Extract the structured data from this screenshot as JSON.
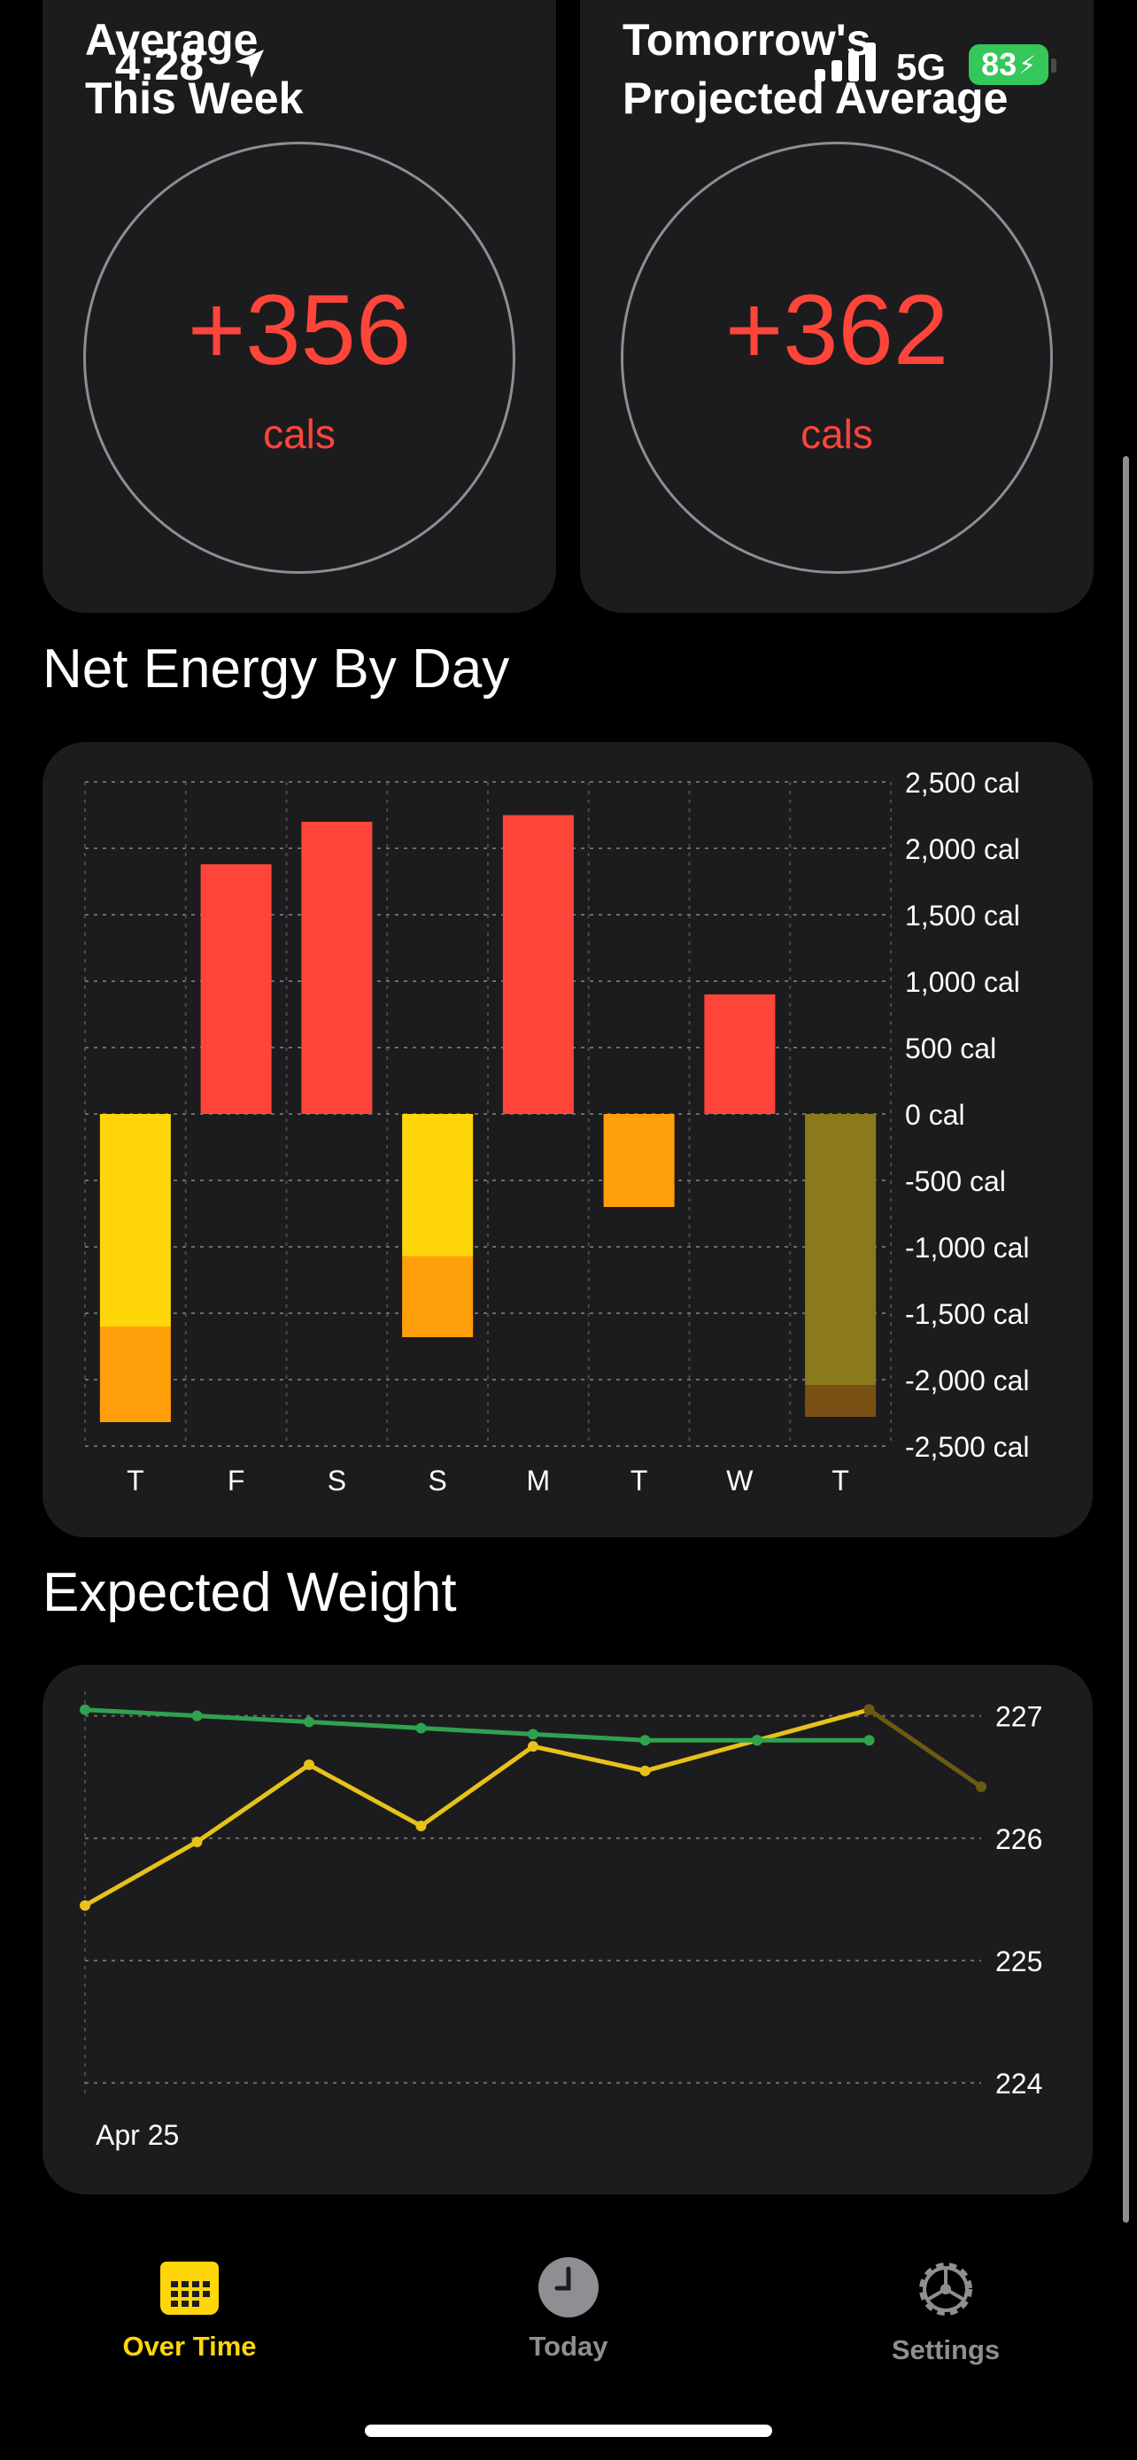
{
  "status": {
    "time": "4:28",
    "network": "5G",
    "battery": "83"
  },
  "summary": [
    {
      "title": "Average\nThis Week",
      "value": "+356",
      "unit": "cals"
    },
    {
      "title": "Tomorrow's\nProjected Average",
      "value": "+362",
      "unit": "cals"
    }
  ],
  "net_energy": {
    "title": "Net Energy By Day"
  },
  "expected_weight": {
    "title": "Expected Weight"
  },
  "tabs": [
    {
      "label": "Over Time",
      "icon": "calendar-icon",
      "active": true
    },
    {
      "label": "Today",
      "icon": "clock-icon",
      "active": false
    },
    {
      "label": "Settings",
      "icon": "gear-icon",
      "active": false
    }
  ],
  "colors": {
    "accent": "#ffd60a",
    "surplus": "#ff453a",
    "deficit_yellow": "#ffd60a",
    "deficit_orange": "#ff9f0a",
    "projected": "#8a7a1c",
    "trend_green": "#30a14e",
    "card": "#1c1c1e"
  },
  "chart_data": [
    {
      "type": "bar",
      "title": "Net Energy By Day",
      "categories": [
        "T",
        "F",
        "S",
        "S",
        "M",
        "T",
        "W",
        "T"
      ],
      "series": [
        {
          "values": [
            -2320,
            1880,
            2200,
            -1680,
            2250,
            -700,
            900,
            -2280
          ]
        }
      ],
      "segments": [
        [
          {
            "value": -1600,
            "color": "#ffd60a"
          },
          {
            "value": -720,
            "color": "#ff9f0a"
          }
        ],
        [
          {
            "value": 1880,
            "color": "#ff453a"
          }
        ],
        [
          {
            "value": 2200,
            "color": "#ff453a"
          }
        ],
        [
          {
            "value": -1070,
            "color": "#ffd60a"
          },
          {
            "value": -610,
            "color": "#ff9f0a"
          }
        ],
        [
          {
            "value": 2250,
            "color": "#ff453a"
          }
        ],
        [
          {
            "value": -700,
            "color": "#ff9f0a"
          }
        ],
        [
          {
            "value": 900,
            "color": "#ff453a"
          }
        ],
        [
          {
            "value": -2040,
            "color": "#8a7a1c"
          },
          {
            "value": -240,
            "color": "#7a4f14"
          }
        ]
      ],
      "ylim": [
        -2500,
        2500
      ],
      "yticks": [
        2500,
        2000,
        1500,
        1000,
        500,
        0,
        -500,
        -1000,
        -1500,
        -2000,
        -2500
      ],
      "ytick_labels": [
        "2,500 cal",
        "2,000 cal",
        "1,500 cal",
        "1,000 cal",
        "500 cal",
        "0 cal",
        "-500 cal",
        "-1,000 cal",
        "-1,500 cal",
        "-2,000 cal",
        "-2,500 cal"
      ],
      "grid": true
    },
    {
      "type": "line",
      "title": "Expected Weight",
      "x_label_first": "Apr 25",
      "x": [
        0,
        1,
        2,
        3,
        4,
        5,
        6,
        7,
        8
      ],
      "series": [
        {
          "values": [
            225.45,
            225.97,
            226.6,
            226.1,
            226.75,
            226.55,
            226.8,
            227.05
          ],
          "color": "#e6c21a"
        },
        {
          "values": [
            227.05,
            227.0,
            226.95,
            226.9,
            226.85,
            226.8,
            226.8,
            226.8
          ],
          "color": "#30a14e"
        },
        {
          "values": [
            null,
            null,
            null,
            null,
            null,
            null,
            null,
            227.05,
            226.42
          ],
          "color": "#6b5a12"
        }
      ],
      "ylim": [
        223.9,
        227.2
      ],
      "yticks": [
        227,
        226,
        225,
        224
      ],
      "ytick_labels": [
        "227",
        "226",
        "225",
        "224"
      ],
      "grid": true
    }
  ]
}
